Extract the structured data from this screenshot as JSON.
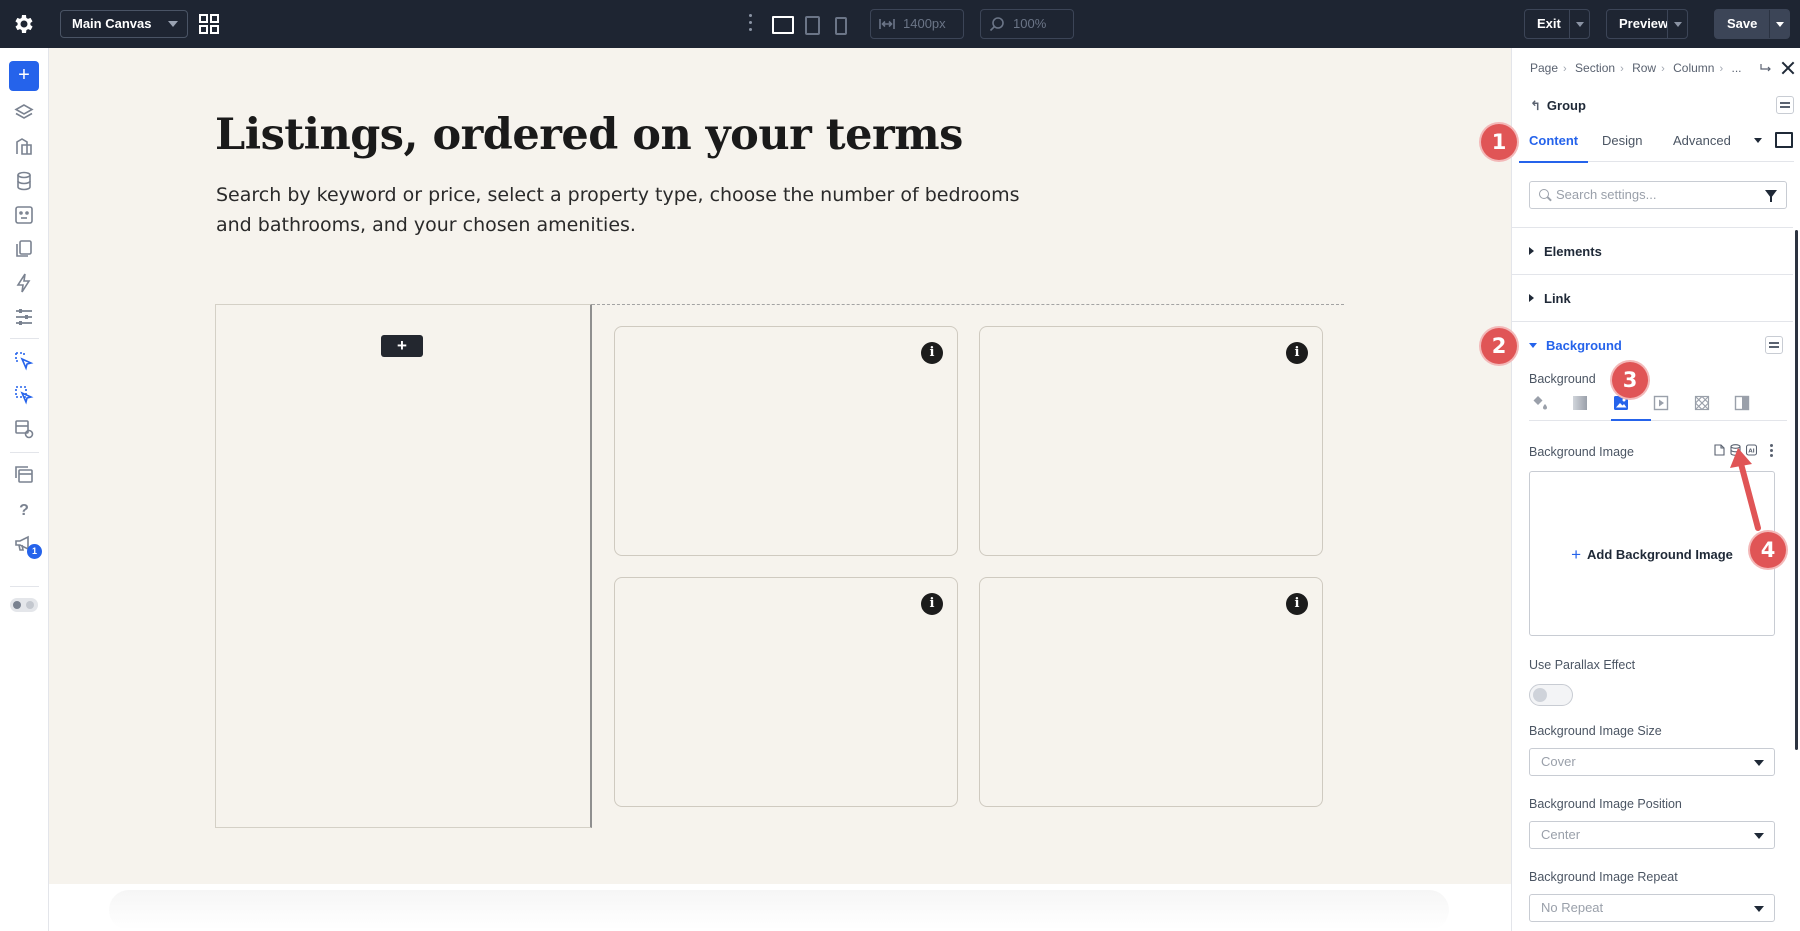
{
  "topbar": {
    "canvas_select": "Main Canvas",
    "width_value": "1400px",
    "zoom_value": "100%",
    "exit_label": "Exit",
    "preview_label": "Preview",
    "save_label": "Save"
  },
  "rail": {
    "notification_count": "1"
  },
  "canvas": {
    "title": "Listings, ordered on your terms",
    "description": "Search by keyword or price, select a property type, choose the number of bedrooms and bathrooms, and your chosen amenities.",
    "add_button": "+",
    "info_glyph": "i"
  },
  "panel": {
    "breadcrumb": [
      "Page",
      "Section",
      "Row",
      "Column",
      "..."
    ],
    "group_label": "Group",
    "tabs": [
      "Content",
      "Design",
      "Advanced"
    ],
    "active_tab": "Content",
    "search_placeholder": "Search settings...",
    "sections": {
      "elements": "Elements",
      "link": "Link",
      "background": "Background"
    },
    "background": {
      "type_label": "Background",
      "type_tabs": [
        "color-fill-icon",
        "gradient-icon",
        "image-icon",
        "video-icon",
        "pattern-icon",
        "mask-icon"
      ],
      "active_type": "image-icon",
      "image_label": "Background Image",
      "add_image": "Add Background Image",
      "parallax_label": "Use Parallax Effect",
      "parallax_on": false,
      "size_label": "Background Image Size",
      "size_value": "Cover",
      "position_label": "Background Image Position",
      "position_value": "Center",
      "repeat_label": "Background Image Repeat",
      "repeat_value": "No Repeat"
    }
  },
  "annotations": [
    "1",
    "2",
    "3",
    "4"
  ],
  "colors": {
    "topbar": "#1e2532",
    "accent": "#2563eb",
    "annotation": "#e05556",
    "canvas_bg": "#f6f3ed"
  }
}
